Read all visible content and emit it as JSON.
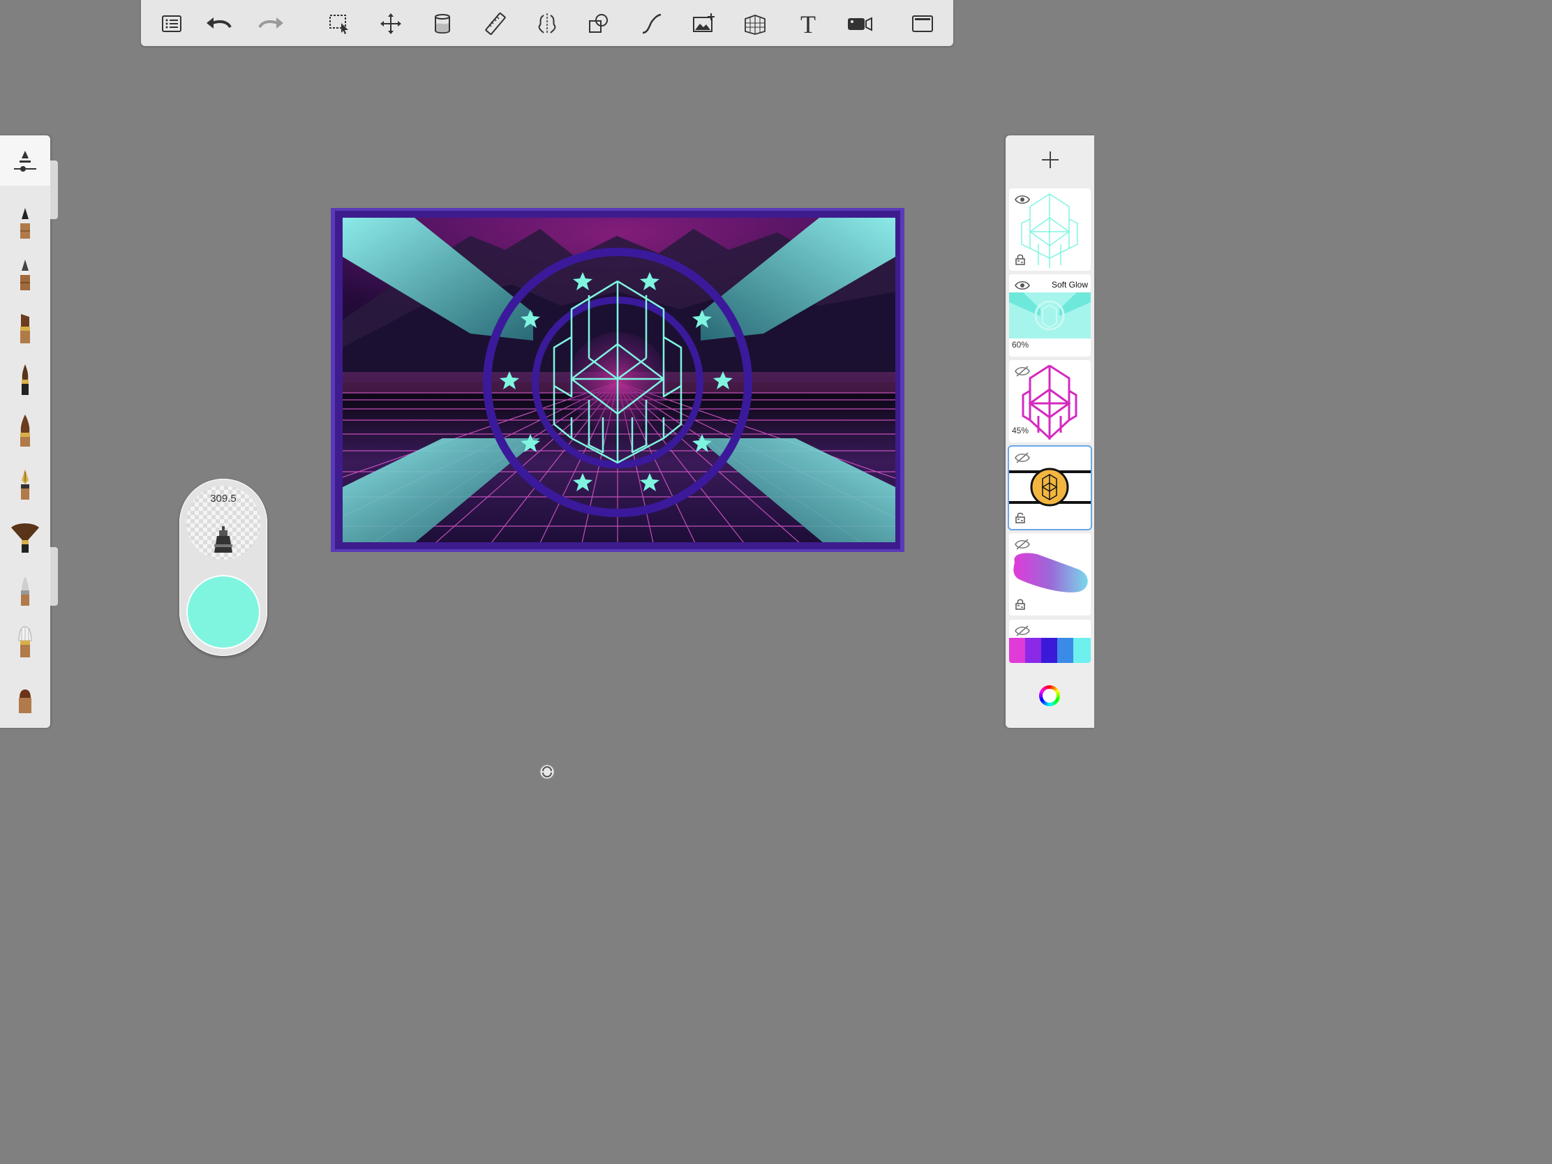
{
  "toolbar": {
    "tools": [
      "list",
      "undo",
      "redo",
      "selection",
      "transform",
      "fill",
      "ruler",
      "symmetry",
      "shapes",
      "stroke",
      "import-image",
      "perspective",
      "text",
      "record",
      "fullscreen"
    ]
  },
  "brushes": {
    "items": [
      "pencil",
      "pencil-hard",
      "marker-flat",
      "ink-brush",
      "paint-brush",
      "fountain-pen",
      "fan-brush",
      "airbrush",
      "blender",
      "eraser"
    ]
  },
  "puck": {
    "size_value": "309.5",
    "color": "#7ff5e0"
  },
  "layers": {
    "items": [
      {
        "visible": true,
        "locked": true,
        "mode": "",
        "opacity": ""
      },
      {
        "visible": true,
        "locked": false,
        "mode": "Soft Glow",
        "opacity": "60%"
      },
      {
        "visible": false,
        "locked": false,
        "mode": "",
        "opacity": "45%"
      },
      {
        "visible": false,
        "locked": true,
        "mode": "",
        "opacity": "",
        "active": true
      },
      {
        "visible": false,
        "locked": true,
        "mode": "",
        "opacity": ""
      },
      {
        "visible": false,
        "locked": false,
        "mode": "",
        "opacity": ""
      }
    ]
  },
  "colors": {
    "accent": "#7ff5e0",
    "selection": "#6aa6e6",
    "canvas_bg": "#808080"
  }
}
